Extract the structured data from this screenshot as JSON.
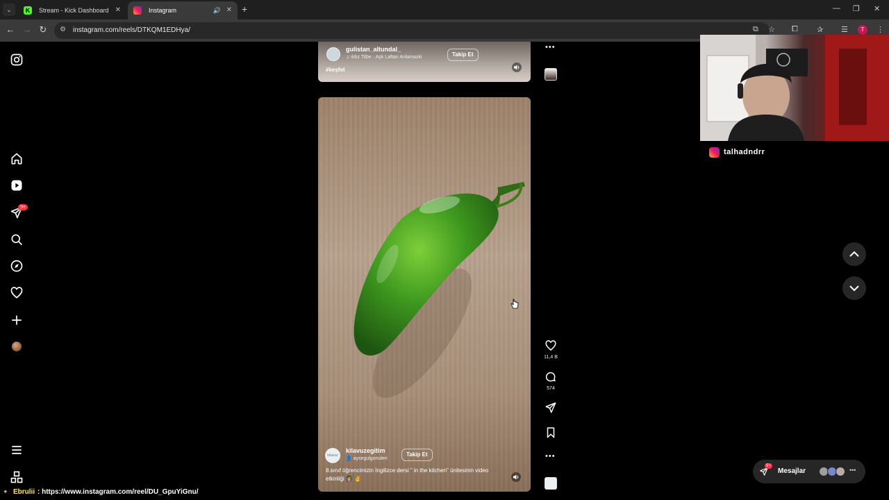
{
  "browser": {
    "tabs": [
      {
        "title": "Stream - Kick Dashboard",
        "favicon": "kick-icon",
        "active": false
      },
      {
        "title": "Instagram",
        "favicon": "instagram-icon",
        "active": true
      }
    ],
    "url": "instagram.com/reels/DTKQM1EDHya/",
    "profile_initial": "T"
  },
  "nav": {
    "notification_badge": "9+"
  },
  "reel_previous": {
    "username": "gulistan_altundal_",
    "music": "ıldız Tilbe · Aşk Laftan Anlamazki",
    "follow_label": "Takip Et",
    "hashtag": "#keşfet"
  },
  "reel_current": {
    "username": "kilavuzegitim",
    "tagged_user": "aysegulgonuleri",
    "follow_label": "Takip Et",
    "caption": "8.sınıf öğrencimizin İngilizce dersi \" in the kitchen\" ünitesinin video etkinliği 👩‍🏫 ✌️",
    "avatar_text": "kilavuz",
    "likes": "11,4 B",
    "comments": "574"
  },
  "messages": {
    "label": "Mesajlar",
    "badge": "9+"
  },
  "overlay": {
    "streamer": "talhadndrr",
    "chat_user": "Ebrulii",
    "chat_message": ": https://www.instagram.com/reel/DU_GpuYiGnu/"
  },
  "colors": {
    "instagram_bg": "#000000",
    "notification_red": "#ff3040",
    "kick_green": "#53fc18",
    "chat_username": "#ffeb3b"
  }
}
